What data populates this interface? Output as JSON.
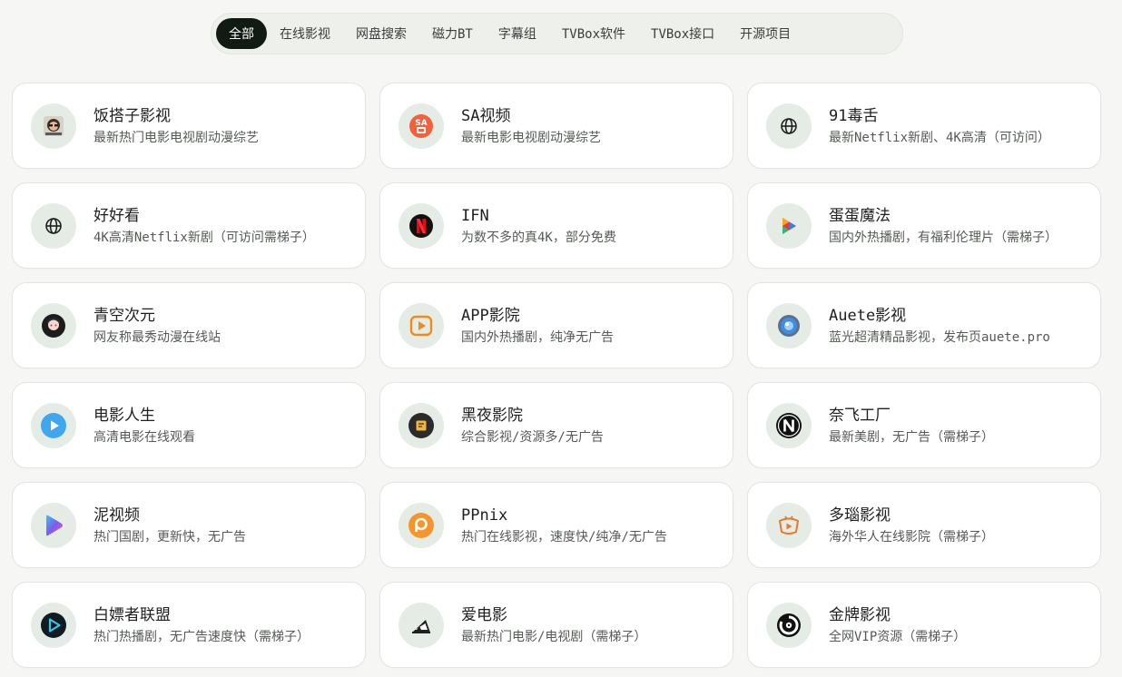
{
  "tabs": [
    {
      "label": "全部",
      "active": true
    },
    {
      "label": "在线影视",
      "active": false
    },
    {
      "label": "网盘搜索",
      "active": false
    },
    {
      "label": "磁力BT",
      "active": false
    },
    {
      "label": "字幕组",
      "active": false
    },
    {
      "label": "TVBox软件",
      "active": false
    },
    {
      "label": "TVBox接口",
      "active": false
    },
    {
      "label": "开源项目",
      "active": false
    }
  ],
  "cards": [
    {
      "title": "饭搭子影视",
      "desc": "最新热门电影电视剧动漫综艺",
      "icon": "fandazi-avatar-icon"
    },
    {
      "title": "SA视频",
      "desc": "最新电影电视剧动漫综艺",
      "icon": "sa-logo-icon"
    },
    {
      "title": "91毒舌",
      "desc": "最新Netflix新剧、4K高清（可访问）",
      "icon": "globe-icon"
    },
    {
      "title": "好好看",
      "desc": "4K高清Netflix新剧（可访问需梯子）",
      "icon": "globe-icon"
    },
    {
      "title": "IFN",
      "desc": "为数不多的真4K，部分免费",
      "icon": "netflix-n-icon"
    },
    {
      "title": "蛋蛋魔法",
      "desc": "国内外热播剧，有福利伦理片（需梯子）",
      "icon": "colorful-play-icon"
    },
    {
      "title": "青空次元",
      "desc": "网友称最秀动漫在线站",
      "icon": "anime-avatar-icon"
    },
    {
      "title": "APP影院",
      "desc": "国内外热播剧，纯净无广告",
      "icon": "orange-play-screen-icon"
    },
    {
      "title": "Auete影视",
      "desc": "蓝光超清精品影视，发布页auete.pro",
      "icon": "blue-orb-icon"
    },
    {
      "title": "电影人生",
      "desc": "高清电影在线观看",
      "icon": "blue-play-circle-icon"
    },
    {
      "title": "黑夜影院",
      "desc": "综合影视/资源多/无广告",
      "icon": "dark-note-icon"
    },
    {
      "title": "奈飞工厂",
      "desc": "最新美剧，无广告（需梯子）",
      "icon": "n-circle-icon"
    },
    {
      "title": "泥视频",
      "desc": "热门国剧，更新快，无广告",
      "icon": "gradient-play-icon"
    },
    {
      "title": "PPnix",
      "desc": "热门在线影视，速度快/纯净/无广告",
      "icon": "orange-p-icon"
    },
    {
      "title": "多瑙影视",
      "desc": "海外华人在线影院（需梯子）",
      "icon": "orange-tv-icon"
    },
    {
      "title": "白嫖者联盟",
      "desc": "热门热播剧，无广告速度快（需梯子）",
      "icon": "cyan-play-icon"
    },
    {
      "title": "爱电影",
      "desc": "最新热门电影/电视剧（需梯子）",
      "icon": "clapper-icon"
    },
    {
      "title": "金牌影视",
      "desc": "全网VIP资源（需梯子）",
      "icon": "vinyl-icon"
    }
  ]
}
